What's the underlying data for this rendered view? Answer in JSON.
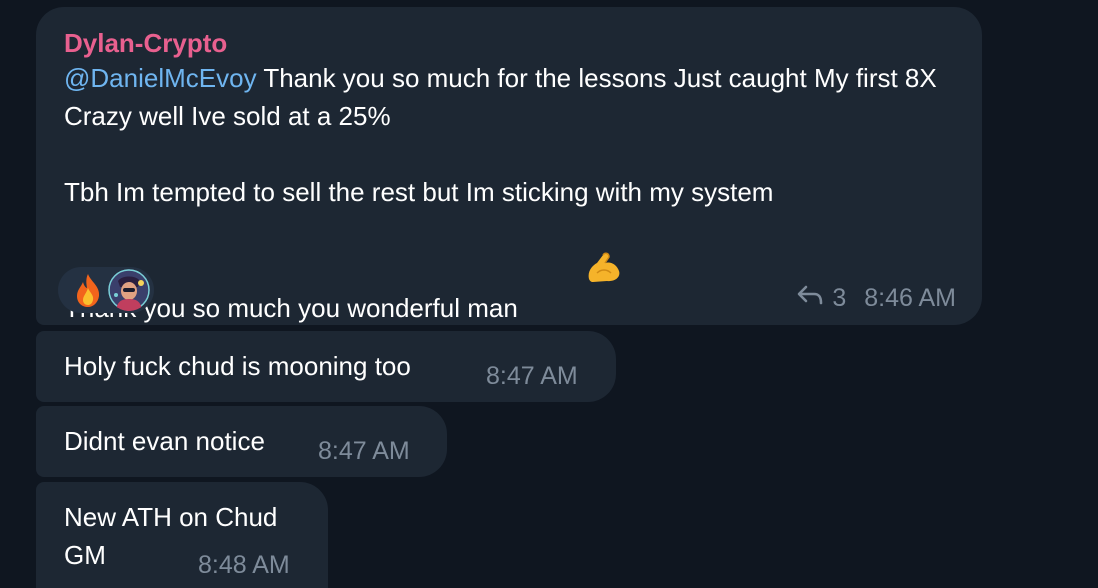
{
  "messages": [
    {
      "sender": "Dylan-Crypto",
      "mention": "@DanielMcEvoy",
      "text_after_mention": " Thank you so much for the lessons Just caught My first 8X Crazy well Ive sold at a 25%",
      "text_p2_line1": "Tbh Im tempted to sell the rest but Im sticking with my system",
      "text_p2_line2": "Thank you so much you wonderful man ",
      "emoji": "flexed-biceps",
      "reactions": [
        "fire-emoji",
        "user-avatar"
      ],
      "reply_count": "3",
      "time": "8:46 AM"
    },
    {
      "text": "Holy fuck chud is mooning too",
      "time": "8:47 AM"
    },
    {
      "text": "Didnt evan notice",
      "time": "8:47 AM"
    },
    {
      "text": "New ATH on Chud GM",
      "time": "8:48 AM"
    }
  ],
  "colors": {
    "background": "#0f1620",
    "bubble": "#1d2733",
    "sender": "#e8608f",
    "mention": "#6fb5f0",
    "meta": "#7e8b9a"
  }
}
